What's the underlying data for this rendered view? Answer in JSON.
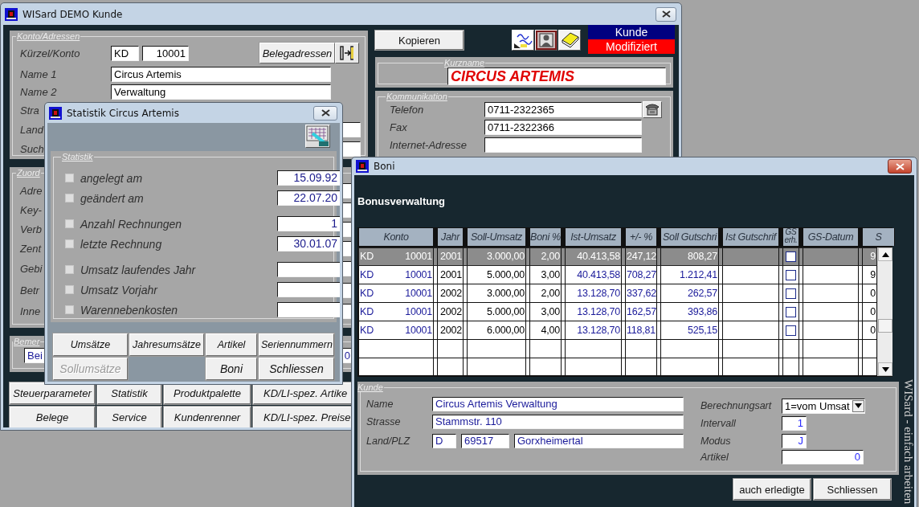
{
  "main_window": {
    "title": "WISard DEMO Kunde",
    "konto_panel": {
      "legend": "Konto/Adressen",
      "kuerzel_label": "Kürzel/Konto",
      "kuerzel": "KD",
      "konto": "10001",
      "belegadressen_button": "Belegadressen",
      "rows": [
        {
          "label": "Name 1",
          "value": "Circus Artemis"
        },
        {
          "label": "Name 2",
          "value": "Verwaltung"
        },
        {
          "label": "Stra"
        },
        {
          "label": "Land"
        },
        {
          "label": "Such"
        }
      ]
    },
    "zuordnung_panel": {
      "legend": "Zuord",
      "labels": [
        "Adre",
        "Key-",
        "Verb",
        "Zent",
        "Gebi",
        "Betr",
        "Inne"
      ]
    },
    "bemerkung_panel": {
      "legend": "Bemer",
      "value": "Bei",
      "value_tail": "0"
    },
    "button_rows": [
      [
        "Steuerparameter",
        "Statistik",
        "Produktpalette",
        "KD/LI-spez. Artike"
      ],
      [
        "Belege",
        "Service",
        "Kundenrenner",
        "KD/LI-spez. Preise"
      ]
    ],
    "copy_button": "Kopieren",
    "record_type": "Kunde",
    "record_state": "Modifiziert",
    "kurzname_panel": {
      "legend": "Kurzname",
      "value": "CIRCUS ARTEMIS"
    },
    "kommunikation_panel": {
      "legend": "Kommunikation",
      "rows": [
        {
          "label": "Telefon",
          "value": "0711-2322365"
        },
        {
          "label": "Fax",
          "value": "0711-2322366"
        },
        {
          "label": "Internet-Adresse"
        }
      ]
    }
  },
  "statistik_window": {
    "title": "Statistik Circus Artemis",
    "panel": {
      "legend": "Statistik",
      "groups": [
        [
          {
            "label": "angelegt am",
            "value": "15.09.92",
            "checked": false
          },
          {
            "label": "geändert am",
            "value": "22.07.20",
            "checked": false
          }
        ],
        [
          {
            "label": "Anzahl Rechnungen",
            "value": "1",
            "checked": false
          },
          {
            "label": "letzte Rechnung",
            "value": "30.01.07",
            "checked": false
          }
        ],
        [
          {
            "label": "Umsatz laufendes Jahr",
            "checked": false
          },
          {
            "label": "Umsatz Vorjahr",
            "checked": false
          },
          {
            "label": "Warennebenkosten",
            "checked": false
          }
        ]
      ]
    },
    "buttons_top": [
      {
        "label": "Umsätze",
        "disabled": false
      },
      {
        "label": "Jahresumsätze",
        "disabled": false
      },
      {
        "label": "Artikel",
        "disabled": false
      },
      {
        "label": "Seriennummern",
        "disabled": false
      }
    ],
    "buttons_bottom_left": [
      {
        "label": "Sollumsätze",
        "disabled": true
      }
    ],
    "buttons_bottom_right": [
      {
        "label": "Boni",
        "disabled": false
      },
      {
        "label": "Schliessen",
        "disabled": false
      }
    ]
  },
  "boni_window": {
    "title": "Boni",
    "heading": "Bonusverwaltung",
    "table": {
      "columns": [
        "Konto",
        "Jahr",
        "Soll-Umsatz",
        "Boni %",
        "Ist-Umsatz",
        "+/- %",
        "Soll Gutschri",
        "Ist Gutschrif",
        "GS erh.",
        "GS-Datum",
        "S"
      ],
      "rows": [
        {
          "konto_prefix": "KD",
          "konto": "10001",
          "jahr": "2001",
          "soll_umsatz": "3.000,00",
          "boni_pct": "2,00",
          "ist_umsatz": "40.413,58",
          "diff_pct": "247,12",
          "soll_gutschrift": "808,27",
          "gs_erhalten": false,
          "s": "9",
          "selected": true
        },
        {
          "konto_prefix": "KD",
          "konto": "10001",
          "jahr": "2001",
          "soll_umsatz": "5.000,00",
          "boni_pct": "3,00",
          "ist_umsatz": "40.413,58",
          "diff_pct": "708,27",
          "soll_gutschrift": "1.212,41",
          "gs_erhalten": false,
          "s": "9",
          "selected": false
        },
        {
          "konto_prefix": "KD",
          "konto": "10001",
          "jahr": "2002",
          "soll_umsatz": "3.000,00",
          "boni_pct": "2,00",
          "ist_umsatz": "13.128,70",
          "diff_pct": "337,62",
          "soll_gutschrift": "262,57",
          "gs_erhalten": false,
          "s": "0",
          "selected": false
        },
        {
          "konto_prefix": "KD",
          "konto": "10001",
          "jahr": "2002",
          "soll_umsatz": "5.000,00",
          "boni_pct": "3,00",
          "ist_umsatz": "13.128,70",
          "diff_pct": "162,57",
          "soll_gutschrift": "393,86",
          "gs_erhalten": false,
          "s": "0",
          "selected": false
        },
        {
          "konto_prefix": "KD",
          "konto": "10001",
          "jahr": "2002",
          "soll_umsatz": "6.000,00",
          "boni_pct": "4,00",
          "ist_umsatz": "13.128,70",
          "diff_pct": "118,81",
          "soll_gutschrift": "525,15",
          "gs_erhalten": false,
          "s": "0",
          "selected": false
        }
      ]
    },
    "kunde_panel": {
      "legend": "Kunde",
      "name_label": "Name",
      "name": "Circus Artemis Verwaltung",
      "strasse_label": "Strasse",
      "strasse": "Stammstr. 110",
      "ort_label": "Land/PLZ",
      "land": "D",
      "plz": "69517",
      "ort": "Gorxheimertal",
      "berechnungsart_label": "Berechnungsart",
      "berechnungsart": "1=vom Umsat",
      "intervall_label": "Intervall",
      "intervall": "1",
      "modus_label": "Modus",
      "modus": "J",
      "artikel_label": "Artikel",
      "artikel": "0"
    },
    "buttons": [
      "auch erledigte",
      "Schliessen"
    ],
    "side_text": "WISard - einfach arbeiten"
  }
}
